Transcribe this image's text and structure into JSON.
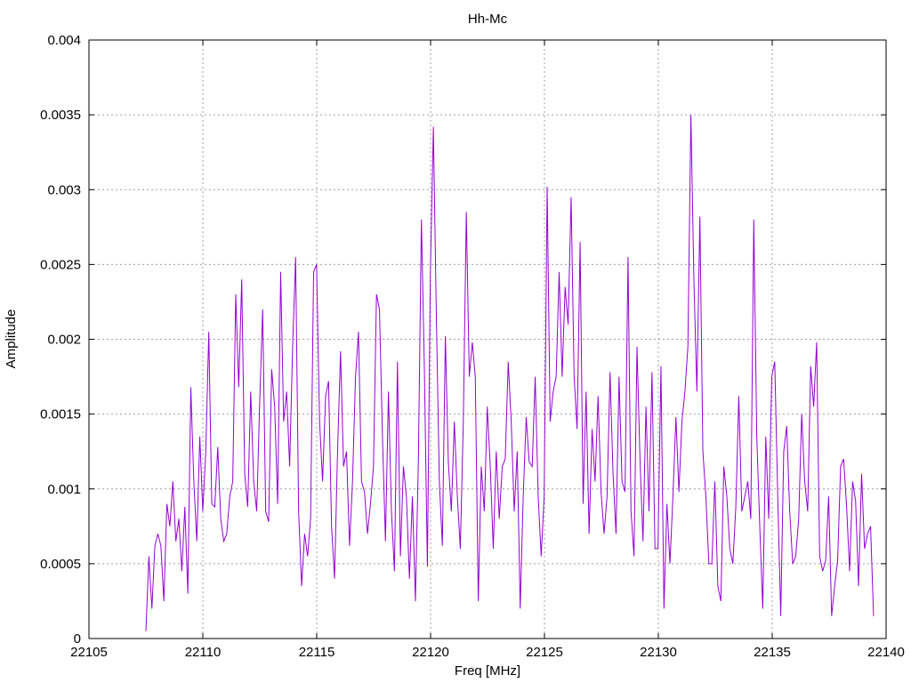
{
  "chart_data": {
    "type": "line",
    "title": "Hh-Mc",
    "xlabel": "Freq [MHz]",
    "ylabel": "Amplitude",
    "xlim": [
      22105,
      22140
    ],
    "ylim": [
      0,
      0.004
    ],
    "x_ticks": [
      "22105",
      "22110",
      "22115",
      "22120",
      "22125",
      "22130",
      "22135",
      "22140"
    ],
    "y_ticks": [
      "0",
      "0.0005",
      "0.001",
      "0.0015",
      "0.002",
      "0.0025",
      "0.003",
      "0.0035",
      "0.004"
    ],
    "x_tick_values": [
      22105,
      22110,
      22115,
      22120,
      22125,
      22130,
      22135,
      22140
    ],
    "y_tick_values": [
      0,
      0.0005,
      0.001,
      0.0015,
      0.002,
      0.0025,
      0.003,
      0.0035,
      0.004
    ],
    "grid": true,
    "series_color": "#9400d3",
    "x_start": 22107.5,
    "x_end": 22139.45,
    "series": [
      {
        "values": [
          5e-05,
          0.00055,
          0.0002,
          0.00062,
          0.0007,
          0.00062,
          0.00025,
          0.0009,
          0.00075,
          0.00105,
          0.00065,
          0.0008,
          0.00045,
          0.00088,
          0.0003,
          0.00168,
          0.00105,
          0.00065,
          0.00135,
          0.00085,
          0.00125,
          0.00205,
          0.0009,
          0.00088,
          0.00128,
          0.0008,
          0.00065,
          0.0007,
          0.00095,
          0.00105,
          0.0023,
          0.00168,
          0.0024,
          0.0011,
          0.00088,
          0.00165,
          0.00105,
          0.00085,
          0.00158,
          0.0022,
          0.00085,
          0.00078,
          0.0018,
          0.00155,
          0.0009,
          0.00245,
          0.00145,
          0.00165,
          0.00115,
          0.00195,
          0.00255,
          0.00085,
          0.00035,
          0.0007,
          0.00055,
          0.0008,
          0.00245,
          0.0025,
          0.00145,
          0.00105,
          0.00162,
          0.00172,
          0.00075,
          0.0004,
          0.00125,
          0.00192,
          0.00115,
          0.00125,
          0.00062,
          0.00105,
          0.00175,
          0.00205,
          0.00105,
          0.00098,
          0.0007,
          0.0009,
          0.00115,
          0.0023,
          0.0022,
          0.00135,
          0.00065,
          0.00165,
          0.00085,
          0.00045,
          0.00185,
          0.00055,
          0.00115,
          0.00095,
          0.0004,
          0.00095,
          0.00025,
          0.0012,
          0.0028,
          0.0018,
          0.00048,
          0.00245,
          0.00342,
          0.00215,
          0.00105,
          0.00062,
          0.00202,
          0.00118,
          0.00085,
          0.00145,
          0.00095,
          0.0006,
          0.00145,
          0.00285,
          0.00175,
          0.00198,
          0.00175,
          0.00025,
          0.00115,
          0.00085,
          0.00155,
          0.00115,
          0.0006,
          0.00125,
          0.0008,
          0.00115,
          0.0012,
          0.00185,
          0.00145,
          0.00085,
          0.00125,
          0.0002,
          0.00095,
          0.00148,
          0.00118,
          0.00115,
          0.00175,
          0.00095,
          0.00055,
          0.00095,
          0.00302,
          0.00145,
          0.00165,
          0.00175,
          0.00245,
          0.00175,
          0.00235,
          0.0021,
          0.00295,
          0.00175,
          0.0014,
          0.00265,
          0.0009,
          0.00165,
          0.0007,
          0.0014,
          0.00105,
          0.00162,
          0.00098,
          0.0007,
          0.00095,
          0.00178,
          0.0011,
          0.0007,
          0.00175,
          0.00105,
          0.00098,
          0.00255,
          0.00085,
          0.00055,
          0.00195,
          0.0012,
          0.00065,
          0.00155,
          0.00085,
          0.00178,
          0.0006,
          0.0006,
          0.00182,
          0.0002,
          0.0009,
          0.0005,
          0.00095,
          0.00148,
          0.00098,
          0.00145,
          0.00165,
          0.00195,
          0.0035,
          0.0024,
          0.00165,
          0.00282,
          0.00125,
          0.00095,
          0.0005,
          0.0005,
          0.00105,
          0.00035,
          0.00025,
          0.00115,
          0.00095,
          0.0006,
          0.0005,
          0.00088,
          0.00162,
          0.00085,
          0.00095,
          0.00105,
          0.0008,
          0.0028,
          0.00135,
          0.00075,
          0.0002,
          0.00135,
          0.0008,
          0.00175,
          0.00185,
          0.00095,
          0.00015,
          0.00125,
          0.00142,
          0.00085,
          0.0005,
          0.00055,
          0.0008,
          0.0015,
          0.00105,
          0.00085,
          0.00182,
          0.00155,
          0.00198,
          0.00055,
          0.00045,
          0.00052,
          0.00095,
          0.00015,
          0.00035,
          0.00052,
          0.00115,
          0.0012,
          0.00088,
          0.00045,
          0.00105,
          0.00092,
          0.00035,
          0.0011,
          0.0006,
          0.0007,
          0.00075,
          0.00015
        ]
      }
    ]
  }
}
